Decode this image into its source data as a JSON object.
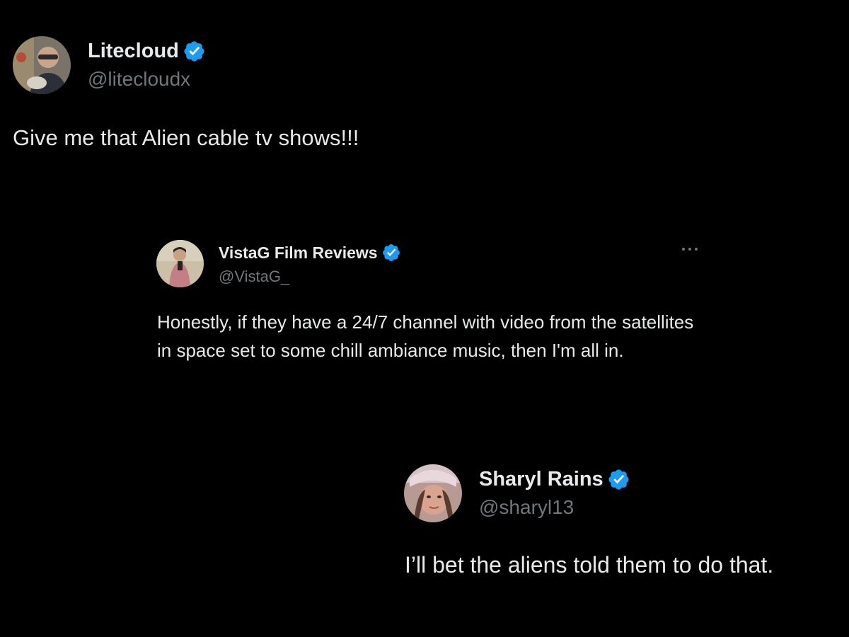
{
  "colors": {
    "background": "#000000",
    "primary_text": "#e7e9ea",
    "secondary_text": "#71767b",
    "verified_badge": "#1d9bf0"
  },
  "posts": [
    {
      "display_name": "Litecloud",
      "handle": "@litecloudx",
      "verified": true,
      "avatar_icon": "avatar-photo",
      "text": "Give me that Alien cable tv shows!!!"
    },
    {
      "display_name": "VistaG Film Reviews",
      "handle": "@VistaG_",
      "verified": true,
      "avatar_icon": "avatar-photo",
      "more_icon": "more-horizontal-icon",
      "text": "Honestly, if they have a 24/7 channel with video from the satellites in space set to some chill ambiance music, then I'm all in."
    },
    {
      "display_name": "Sharyl Rains",
      "handle": "@sharyl13",
      "verified": true,
      "avatar_icon": "avatar-photo",
      "text": "I’ll bet the aliens told them to do that."
    }
  ]
}
